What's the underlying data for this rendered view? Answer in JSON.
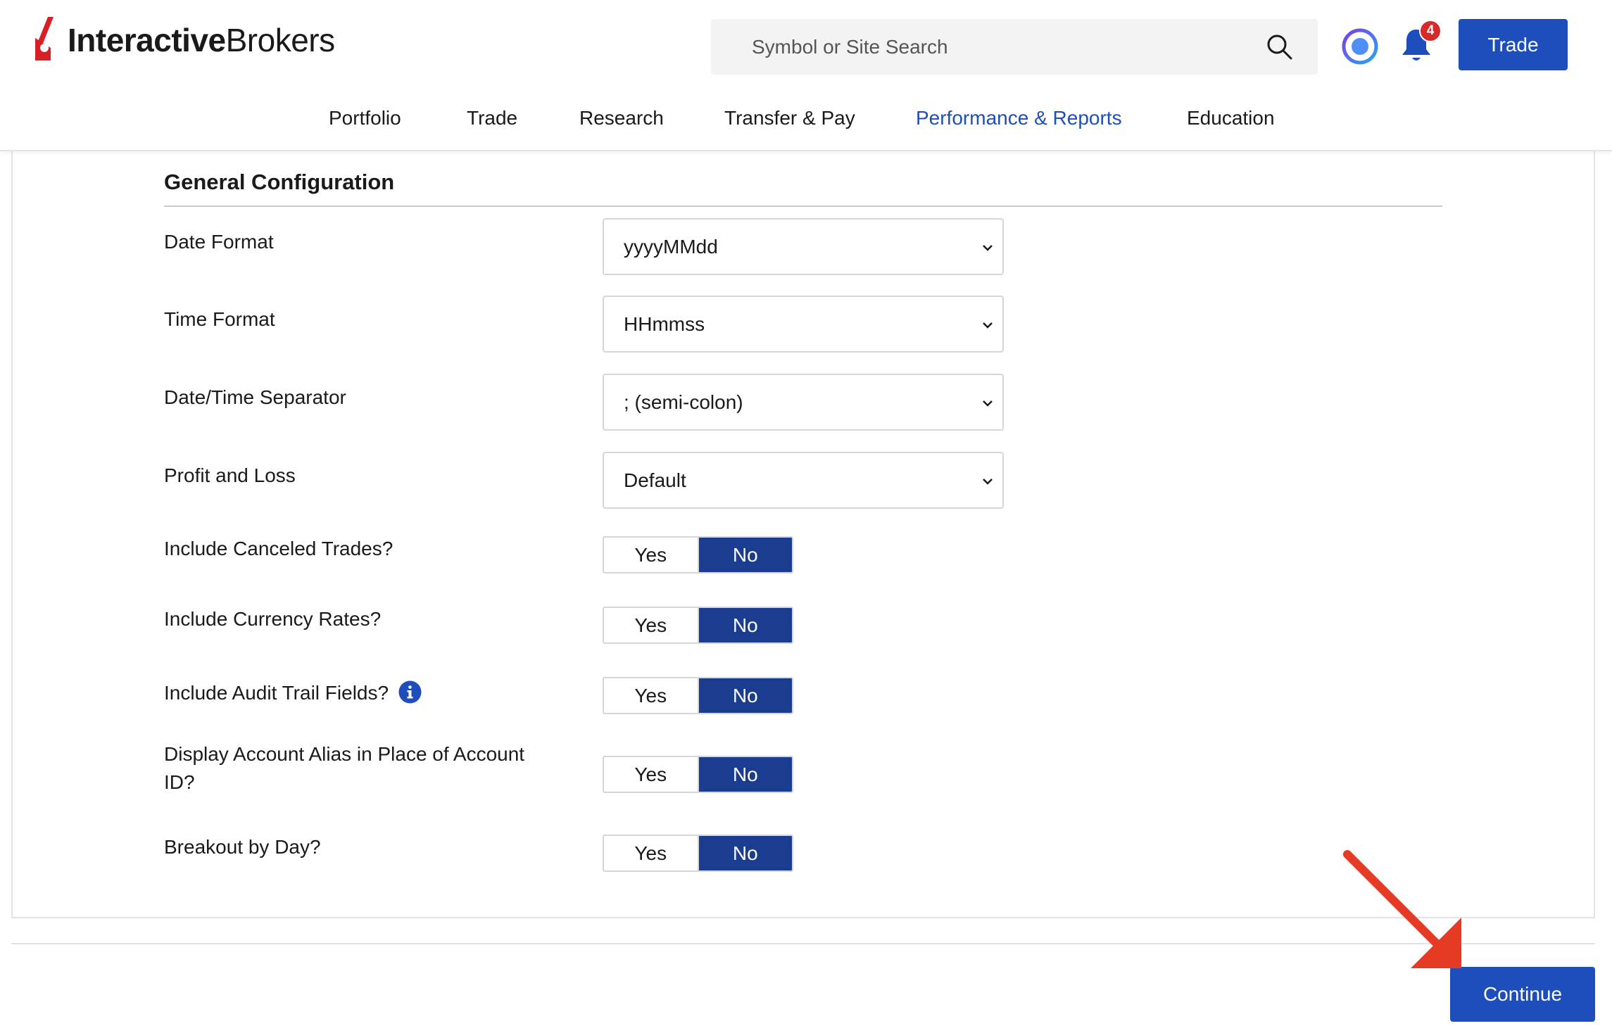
{
  "header": {
    "logo": {
      "part1": "Interactive",
      "part2": "Brokers"
    },
    "search_placeholder": "Symbol or Site Search",
    "notifications_count": "4",
    "trade_button": "Trade"
  },
  "nav": [
    {
      "label": "Portfolio",
      "active": false
    },
    {
      "label": "Trade",
      "active": false
    },
    {
      "label": "Research",
      "active": false
    },
    {
      "label": "Transfer & Pay",
      "active": false
    },
    {
      "label": "Performance & Reports",
      "active": true
    },
    {
      "label": "Education",
      "active": false
    }
  ],
  "section": {
    "title": "General Configuration",
    "selects": [
      {
        "label": "Date Format",
        "value": "yyyyMMdd"
      },
      {
        "label": "Time Format",
        "value": "HHmmss"
      },
      {
        "label": "Date/Time Separator",
        "value": "; (semi-colon)"
      },
      {
        "label": "Profit and Loss",
        "value": "Default"
      }
    ],
    "toggles": [
      {
        "label": "Include Canceled Trades?",
        "yes": "Yes",
        "no": "No",
        "selected": "No"
      },
      {
        "label": "Include Currency Rates?",
        "yes": "Yes",
        "no": "No",
        "selected": "No"
      },
      {
        "label": "Include Audit Trail Fields?",
        "yes": "Yes",
        "no": "No",
        "selected": "No"
      },
      {
        "label": "Display Account Alias in Place of Account ID?",
        "yes": "Yes",
        "no": "No",
        "selected": "No"
      },
      {
        "label": "Breakout by Day?",
        "yes": "Yes",
        "no": "No",
        "selected": "No"
      }
    ]
  },
  "footer": {
    "continue_button": "Continue"
  },
  "colors": {
    "brand_blue": "#1d4ebc",
    "toggle_selected": "#1a3d8f",
    "logo_red": "#d81f26",
    "annotation_arrow": "#e53a23"
  }
}
